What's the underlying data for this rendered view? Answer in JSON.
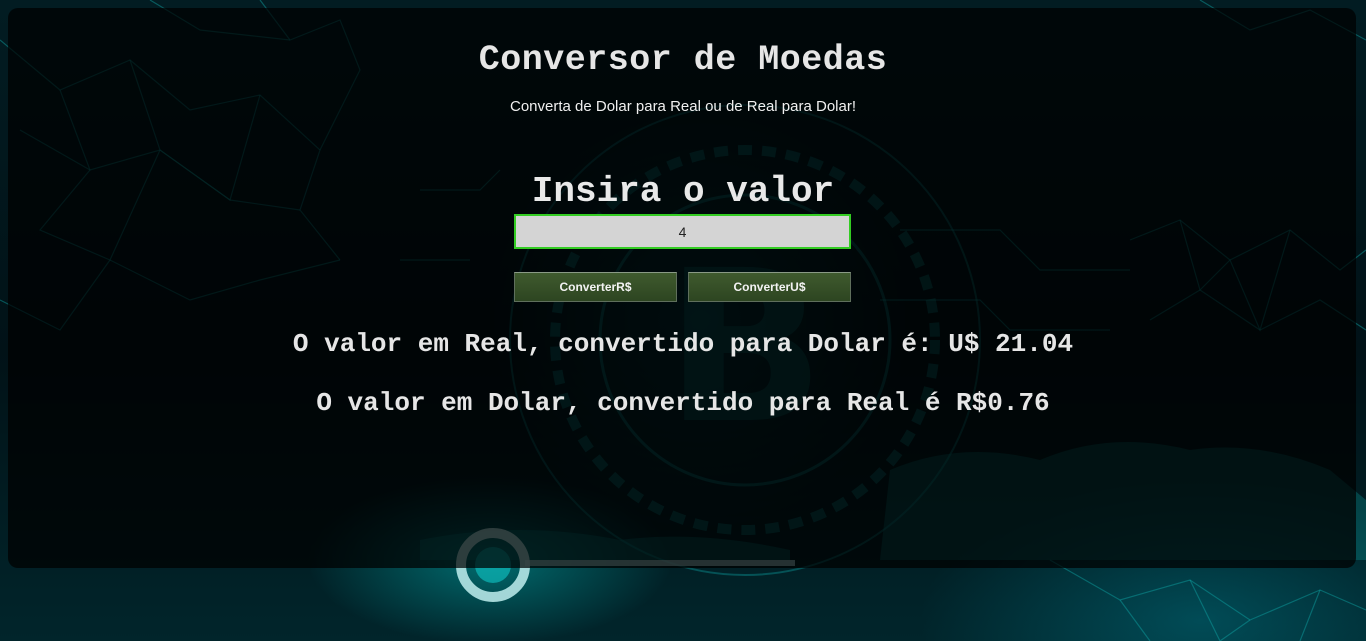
{
  "header": {
    "title": "Conversor de Moedas",
    "subtitle": "Converta de Dolar para Real ou de Real para Dolar!"
  },
  "form": {
    "label": "Insira o valor",
    "input_value": "4",
    "convert_real_label": "ConverterR$",
    "convert_dolar_label": "ConverterU$"
  },
  "results": {
    "real_to_dolar": "O valor em Real, convertido para Dolar é: U$ 21.04",
    "dolar_to_real": "O valor em Dolar, convertido para Real é R$0.76"
  },
  "colors": {
    "panel_background": "#000000",
    "input_border": "#33cc22",
    "button_background": "#3f5a2e",
    "text": "#e6e6e6",
    "background_accent": "#00c8c8"
  },
  "background": {
    "icon": "bitcoin-icon",
    "description_icon": "network-hand-icon"
  }
}
